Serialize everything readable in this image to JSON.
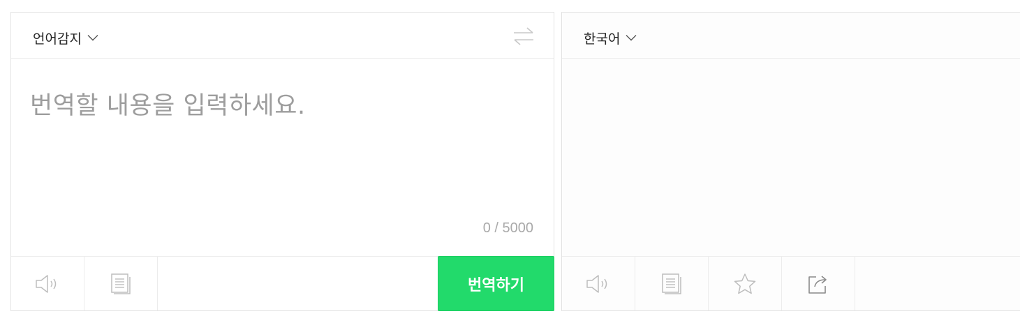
{
  "source": {
    "language": "언어감지",
    "placeholder": "번역할 내용을 입력하세요.",
    "char_count": "0 / 5000",
    "translate_label": "번역하기"
  },
  "target": {
    "language": "한국어"
  },
  "icons": {
    "source_toolbar": [
      "speaker-icon",
      "copy-icon"
    ],
    "target_toolbar": [
      "speaker-icon",
      "copy-icon",
      "star-icon",
      "share-icon"
    ],
    "header": [
      "swap-icon",
      "chevron-down-icon"
    ]
  },
  "colors": {
    "translate_button": "#22da6b",
    "placeholder": "#9d9d9d",
    "border": "#e3e3e3"
  }
}
